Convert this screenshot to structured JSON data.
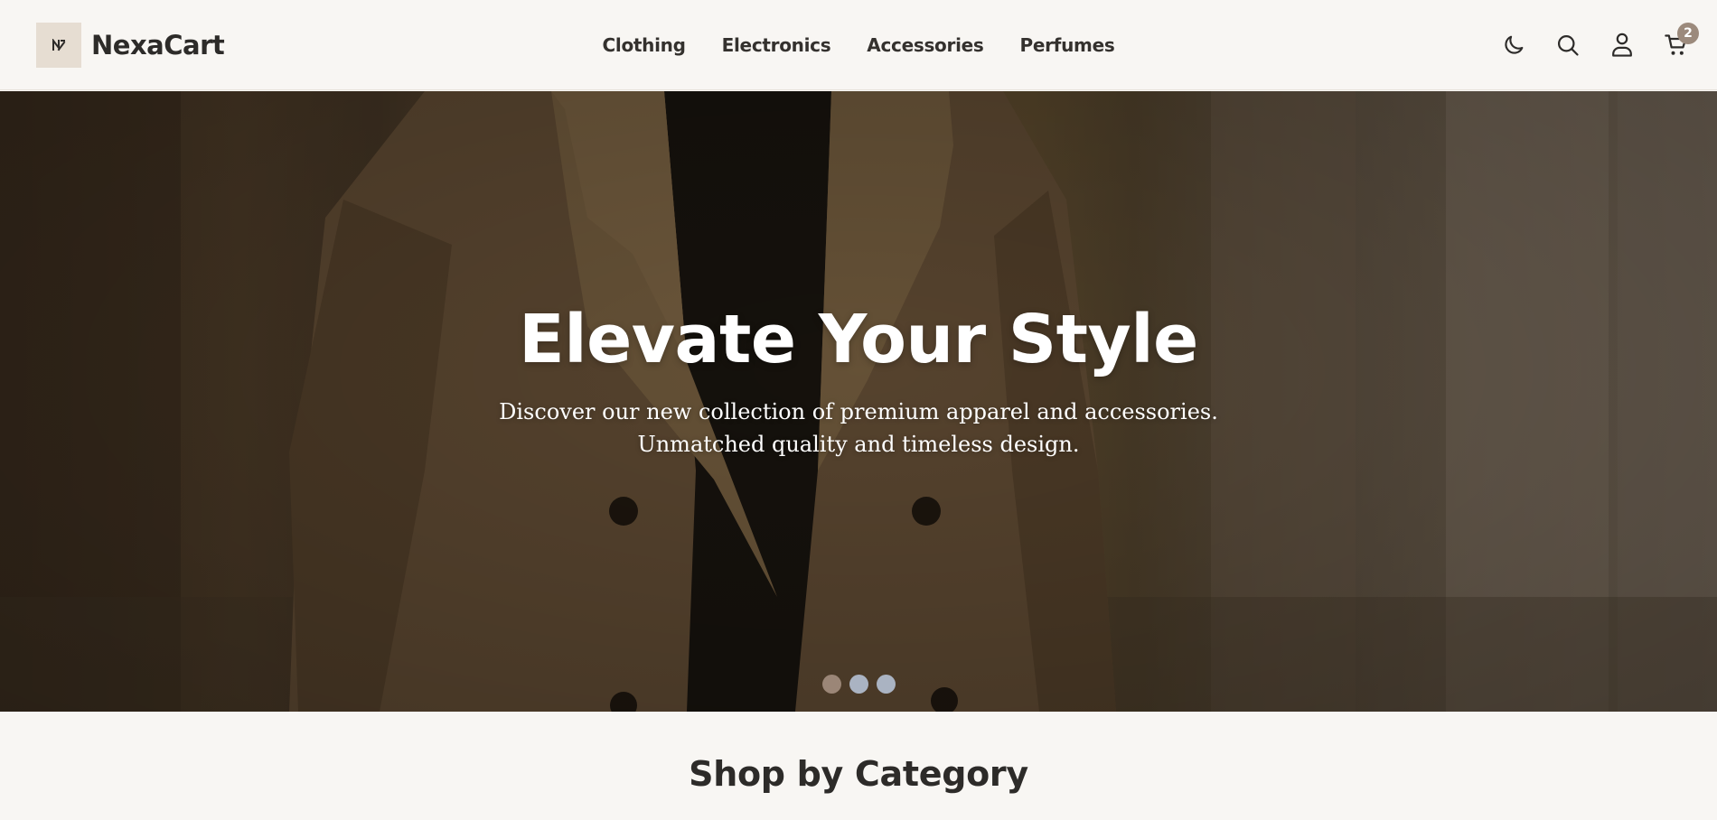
{
  "brand": {
    "name": "NexaCart",
    "mark": "N"
  },
  "nav": {
    "items": [
      "Clothing",
      "Electronics",
      "Accessories",
      "Perfumes"
    ]
  },
  "actions": {
    "icons": [
      "moon-icon",
      "search-icon",
      "user-icon",
      "cart-icon"
    ],
    "cart_count": "2"
  },
  "hero": {
    "title": "Elevate Your Style",
    "subtitle_line1": "Discover our new collection of premium apparel and accessories.",
    "subtitle_line2": "Unmatched quality and timeless design.",
    "slides": 3,
    "active_slide": 1
  },
  "sections": {
    "category_title": "Shop by Category"
  },
  "colors": {
    "background": "#f8f6f3",
    "text": "#2d2b29",
    "accent": "#9b8677",
    "dot_inactive": "#aab3c2"
  }
}
